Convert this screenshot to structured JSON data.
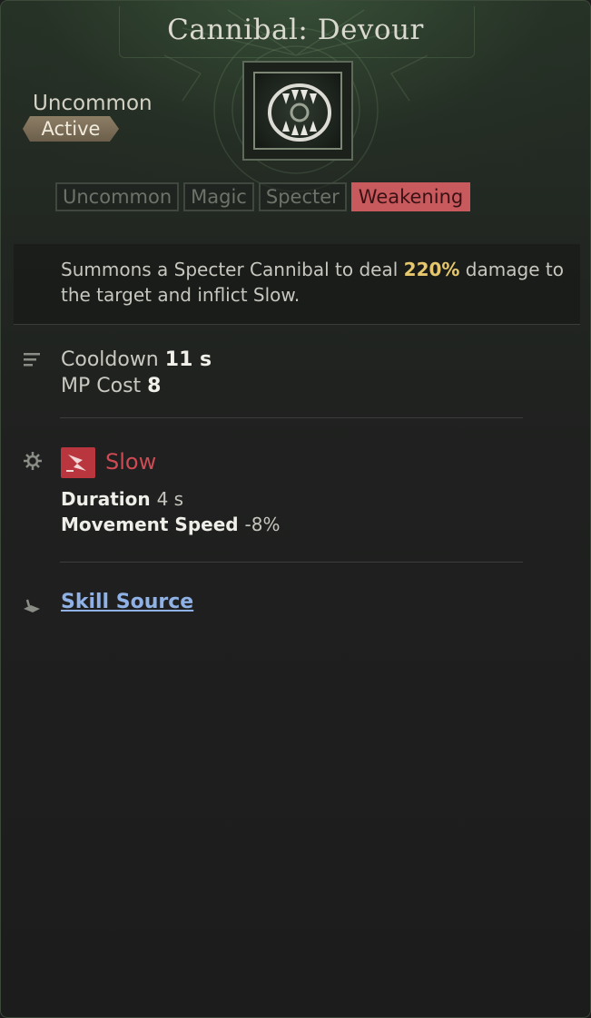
{
  "skill": {
    "title": "Cannibal: Devour",
    "rarity": "Uncommon",
    "type": "Active",
    "icon": "fanged-maw-icon"
  },
  "tags": [
    {
      "label": "Uncommon",
      "active": false
    },
    {
      "label": "Magic",
      "active": false
    },
    {
      "label": "Specter",
      "active": false
    },
    {
      "label": "Weakening",
      "active": true
    }
  ],
  "description": {
    "before": "Summons a Specter Cannibal to deal ",
    "highlight": "220%",
    "after": " damage to the target and inflict Slow."
  },
  "stats": {
    "cooldown_label": "Cooldown",
    "cooldown_value": "11 s",
    "mp_label": "MP Cost",
    "mp_value": "8"
  },
  "effect": {
    "name": "Slow",
    "icon": "slow-effect-icon",
    "duration_label": "Duration",
    "duration_value": "4 s",
    "speed_label": "Movement Speed",
    "speed_value": "-8%"
  },
  "source": {
    "label": "Skill Source"
  },
  "colors": {
    "highlight": "#e6c76e",
    "effect_red": "#cf4a53",
    "tag_active": "#c85a5e",
    "link": "#8fb1e6"
  }
}
